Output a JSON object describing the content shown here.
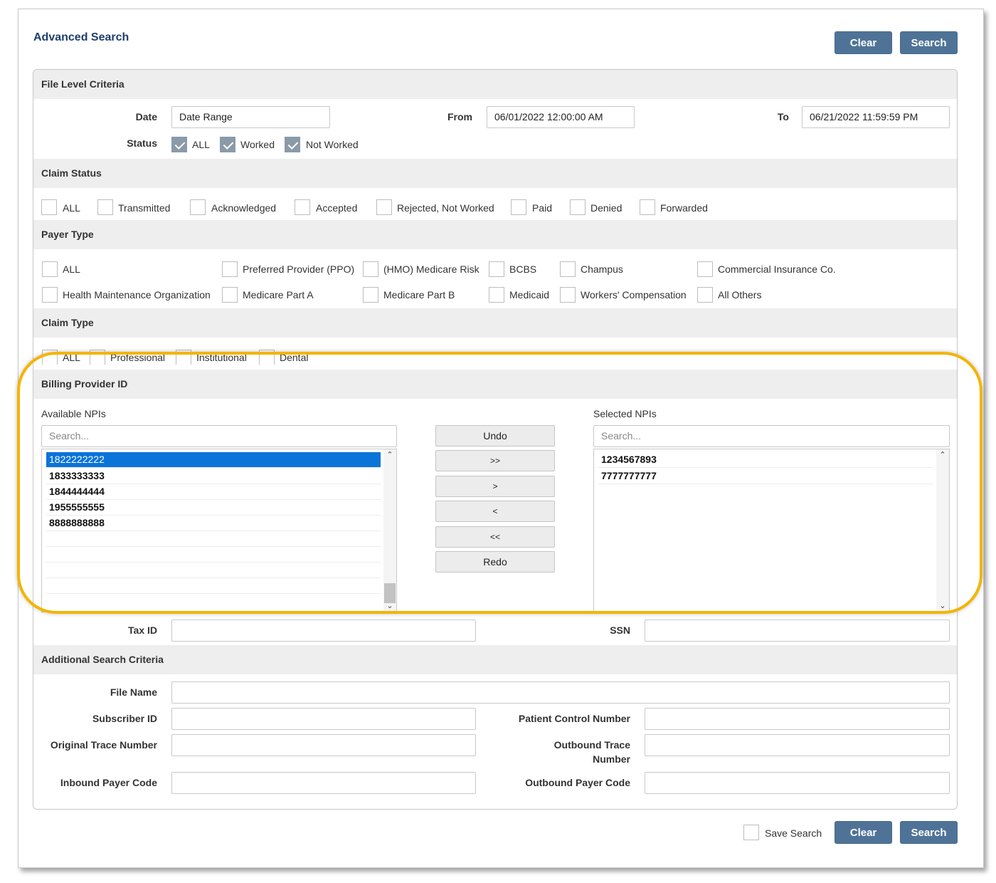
{
  "page": {
    "title": "Advanced Search"
  },
  "top_buttons": {
    "clear": "Clear",
    "search": "Search"
  },
  "file_level": {
    "heading": "File Level Criteria",
    "date_label": "Date",
    "date_value": "Date Range",
    "from_label": "From",
    "from_value": "06/01/2022 12:00:00 AM",
    "to_label": "To",
    "to_value": "06/21/2022 11:59:59 PM",
    "status_label": "Status",
    "status_options": [
      {
        "label": "ALL",
        "checked": true
      },
      {
        "label": "Worked",
        "checked": true
      },
      {
        "label": "Not Worked",
        "checked": true
      }
    ]
  },
  "claim_status": {
    "heading": "Claim Status",
    "options": [
      "ALL",
      "Transmitted",
      "Acknowledged",
      "Accepted",
      "Rejected, Not Worked",
      "Paid",
      "Denied",
      "Forwarded"
    ]
  },
  "payer_type": {
    "heading": "Payer Type",
    "options": [
      "ALL",
      "Preferred Provider (PPO)",
      "(HMO) Medicare Risk",
      "BCBS",
      "Champus",
      "Commercial Insurance Co.",
      "Health Maintenance Organization",
      "Medicare Part A",
      "Medicare Part B",
      "Medicaid",
      "Workers' Compensation",
      "All Others"
    ]
  },
  "claim_type": {
    "heading": "Claim Type",
    "options": [
      "ALL",
      "Professional",
      "Institutional",
      "Dental"
    ]
  },
  "billing_provider": {
    "heading": "Billing Provider ID",
    "available_label": "Available NPIs",
    "available_search_placeholder": "Search...",
    "available": [
      "1822222222",
      "1833333333",
      "1844444444",
      "1955555555",
      "8888888888"
    ],
    "selected_index": 0,
    "selected_label": "Selected NPIs",
    "selected_search_placeholder": "Search...",
    "selected": [
      "1234567893",
      "7777777777"
    ],
    "transfer_buttons": {
      "undo": "Undo",
      "move_all_right": ">>",
      "move_right": ">",
      "move_left": "<",
      "move_all_left": "<<",
      "redo": "Redo"
    }
  },
  "ids": {
    "tax_id_label": "Tax ID",
    "ssn_label": "SSN"
  },
  "additional": {
    "heading": "Additional Search Criteria",
    "file_name_label": "File Name",
    "subscriber_id_label": "Subscriber ID",
    "patient_control_label": "Patient Control Number",
    "original_trace_label": "Original Trace Number",
    "outbound_trace_label_1": "Outbound Trace",
    "outbound_trace_label_2": "Number",
    "inbound_payer_label": "Inbound Payer Code",
    "outbound_payer_label": "Outbound Payer Code"
  },
  "footer": {
    "save_search_label": "Save Search",
    "clear": "Clear",
    "search": "Search"
  },
  "colors": {
    "accent_button": "#4f7397",
    "title": "#1f3e6d",
    "selected_row": "#0a74d8",
    "callout_highlight": "#f4b400"
  }
}
